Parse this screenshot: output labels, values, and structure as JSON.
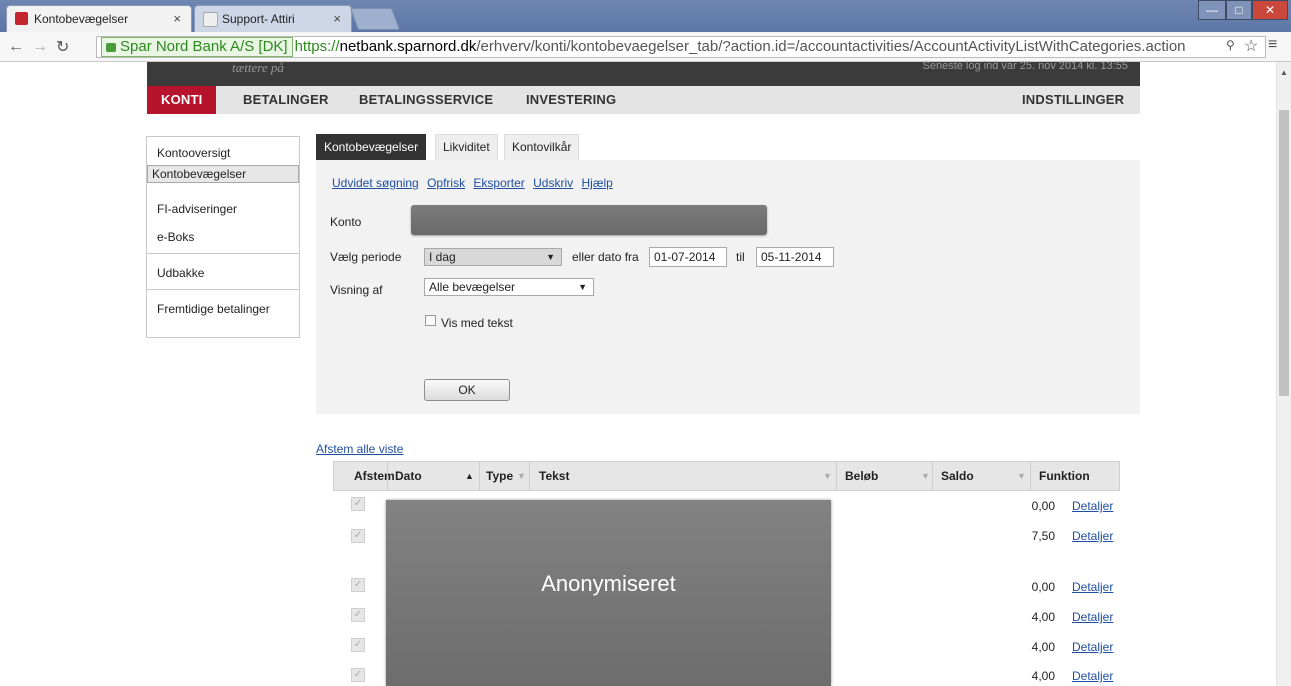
{
  "browser": {
    "tabs": [
      {
        "title": "Kontobevægelser",
        "active": true,
        "favicon_color": "#c4262e"
      },
      {
        "title": "Support- Attiri",
        "active": false,
        "favicon_color": "#d9d9d9"
      }
    ],
    "close_glyph": "×",
    "ev_label": "Spar Nord Bank A/S [DK]",
    "url_scheme": "https://",
    "url_host": "netbank.sparnord.dk",
    "url_path": "/erhverv/konti/kontobevaegelser_tab/?action.id=/accountactivities/AccountActivityListWithCategories.action"
  },
  "bank": {
    "slogan": "tættere på",
    "last_login": "Seneste log ind var 25. nov 2014 kl. 13:55",
    "nav": [
      "KONTI",
      "BETALINGER",
      "BETALINGSSERVICE",
      "INVESTERING"
    ],
    "settings": "INDSTILLINGER",
    "accent": "#b6142c"
  },
  "sidebar": {
    "items": [
      "Kontooversigt",
      "Kontobevægelser",
      "FI-adviseringer",
      "e-Boks",
      "Udbakke",
      "Fremtidige betalinger"
    ]
  },
  "content_tabs": [
    "Kontobevægelser",
    "Likviditet",
    "Kontovilkår"
  ],
  "actions": [
    "Udvidet søgning",
    "Opfrisk",
    "Eksporter",
    "Udskriv",
    "Hjælp"
  ],
  "form": {
    "konto_label": "Konto",
    "period_label": "Vælg periode",
    "period_value": "I dag",
    "date_from_label": "eller dato fra",
    "date_from": "01-07-2014",
    "date_to_label": "til",
    "date_to": "05-11-2014",
    "view_label": "Visning af",
    "view_value": "Alle bevægelser",
    "show_text_label": "Vis med tekst",
    "ok_label": "OK"
  },
  "table": {
    "reconcile_all": "Afstem alle viste",
    "headers": [
      "Afstem",
      "Dato",
      "Type",
      "Tekst",
      "Beløb",
      "Saldo",
      "Funktion"
    ],
    "rows": [
      {
        "saldo": "0,00",
        "action": "Detaljer"
      },
      {
        "saldo": "7,50",
        "action": "Detaljer"
      },
      {
        "saldo": "0,00",
        "action": "Detaljer"
      },
      {
        "saldo": "4,00",
        "action": "Detaljer"
      },
      {
        "saldo": "4,00",
        "action": "Detaljer"
      },
      {
        "saldo": "4,00",
        "action": "Detaljer"
      }
    ]
  },
  "overlay": {
    "text": "Anonymiseret"
  }
}
